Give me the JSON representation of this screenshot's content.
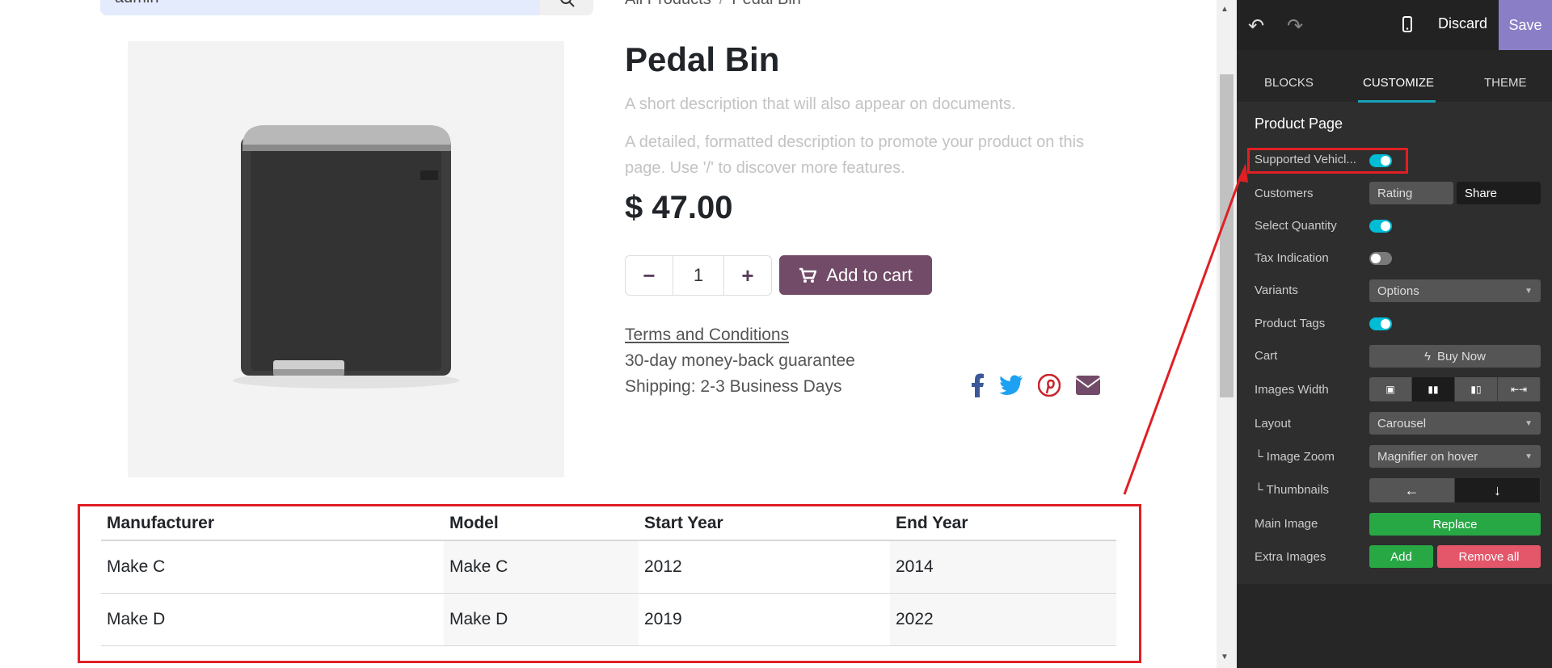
{
  "search": {
    "value": "admin"
  },
  "breadcrumb": {
    "parent": "All Products",
    "current": "Pedal Bin"
  },
  "product": {
    "title": "Pedal Bin",
    "short_description": "A short description that will also appear on documents.",
    "long_description": "A detailed, formatted description to promote your product on this page. Use '/' to discover more features.",
    "price": "$ 47.00",
    "quantity": "1",
    "add_to_cart": "Add to cart",
    "terms": "Terms and Conditions",
    "guarantee": "30-day money-back guarantee",
    "shipping": "Shipping: 2-3 Business Days"
  },
  "social": [
    "facebook-icon",
    "twitter-icon",
    "pinterest-icon",
    "envelope-icon"
  ],
  "colors": {
    "brand": "#714b67",
    "editor_bg": "#2e2e2e",
    "accent": "#17a2b8",
    "save": "#8a7ec7",
    "highlight": "#e01f25",
    "green": "#28a745",
    "red": "#e4566a"
  },
  "vehicles": {
    "headers": [
      "Manufacturer",
      "Model",
      "Start Year",
      "End Year"
    ],
    "rows": [
      [
        "Make C",
        "Make C",
        "2012",
        "2014"
      ],
      [
        "Make D",
        "Make D",
        "2019",
        "2022"
      ]
    ]
  },
  "editor": {
    "discard": "Discard",
    "save": "Save",
    "tabs": [
      "BLOCKS",
      "CUSTOMIZE",
      "THEME"
    ],
    "active_tab": "CUSTOMIZE",
    "section": "Product Page",
    "options": {
      "supported_vehicles": {
        "label": "Supported Vehicl...",
        "on": true
      },
      "customers": {
        "label": "Customers",
        "rating": "Rating",
        "share": "Share"
      },
      "select_quantity": {
        "label": "Select Quantity",
        "on": true
      },
      "tax_indication": {
        "label": "Tax Indication",
        "on": false
      },
      "variants": {
        "label": "Variants",
        "value": "Options"
      },
      "product_tags": {
        "label": "Product Tags",
        "on": true
      },
      "cart": {
        "label": "Cart",
        "value": "Buy Now"
      },
      "images_width": {
        "label": "Images Width"
      },
      "layout": {
        "label": "Layout",
        "value": "Carousel"
      },
      "image_zoom": {
        "label": "└ Image Zoom",
        "value": "Magnifier on hover"
      },
      "thumbnails": {
        "label": "└ Thumbnails"
      },
      "main_image": {
        "label": "Main Image",
        "button": "Replace"
      },
      "extra_images": {
        "label": "Extra Images",
        "add": "Add",
        "remove": "Remove all"
      }
    }
  }
}
